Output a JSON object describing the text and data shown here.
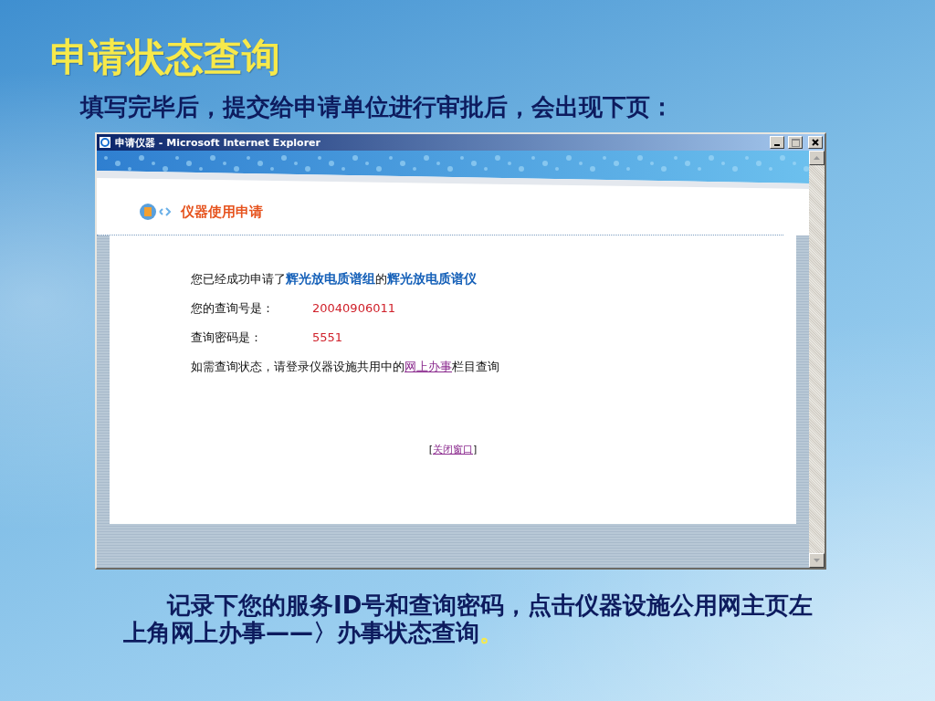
{
  "slide": {
    "title": "申请状态查询",
    "subtitle": "填写完毕后，提交给申请单位进行审批后，会出现下页：",
    "note": "记录下您的服务ID号和查询密码，点击仪器设施公用网主页左上角网上办事——〉办事状态查询",
    "note_end": "。"
  },
  "window": {
    "title": "申请仪器 - Microsoft Internet Explorer"
  },
  "page": {
    "heading": "仪器使用申请",
    "lines": [
      {
        "kind": "sentence",
        "text": "您已经成功申请了**辉光放电质谱组**的**辉光放电质谱仪**"
      },
      {
        "kind": "field",
        "label": "您的查询号是：",
        "value": "20040906011"
      },
      {
        "kind": "field",
        "label": "查询密码是：",
        "value": "5551"
      },
      {
        "kind": "link_sentence",
        "before": "如需查询状态，请登录仪器设施共用中的",
        "link": "网上办事",
        "after": "栏目查询"
      }
    ],
    "close": {
      "before": "[",
      "link": "关闭窗口",
      "after": "]"
    }
  }
}
